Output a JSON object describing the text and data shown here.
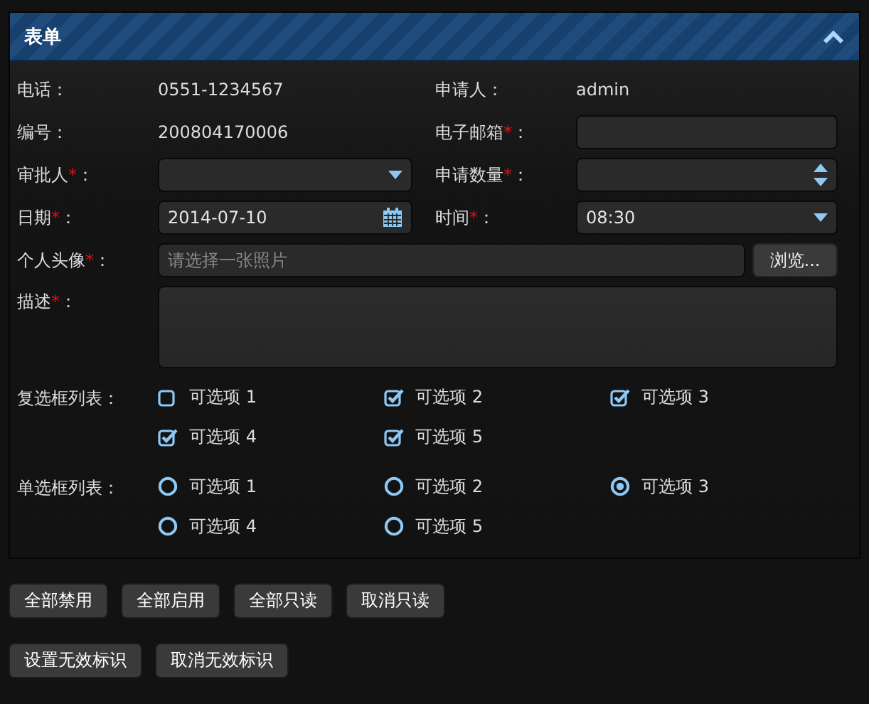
{
  "panel": {
    "title": "表单",
    "expanded": true
  },
  "fields": [
    {
      "kind": "text",
      "label": "电话：",
      "value": "0551-1234567"
    },
    {
      "kind": "text",
      "label": "申请人：",
      "value": "admin"
    },
    {
      "kind": "text",
      "label": "编号：",
      "value": "200804170006"
    },
    {
      "kind": "input",
      "label": "电子邮箱",
      "required_mark": "*",
      "colon": "："
    },
    {
      "kind": "select",
      "label": "审批人",
      "required_mark": "*",
      "colon": "："
    },
    {
      "kind": "spinner",
      "label": "申请数量",
      "required_mark": "*",
      "colon": "："
    },
    {
      "kind": "date",
      "label": "日期",
      "required_mark": "*",
      "colon": "：",
      "value": "2014-07-10"
    },
    {
      "kind": "select",
      "label": "时间",
      "required_mark": "*",
      "colon": "：",
      "value": "08:30"
    },
    {
      "kind": "file",
      "label": "个人头像",
      "required_mark": "*",
      "colon": "：",
      "placeholder": "请选择一张照片",
      "button": "浏览..."
    },
    {
      "kind": "textarea",
      "label": "描述",
      "required_mark": "*",
      "colon": "："
    }
  ],
  "checkbox_group": {
    "label": "复选框列表：",
    "options": [
      {
        "label": "可选项 1",
        "checked": false
      },
      {
        "label": "可选项 2",
        "checked": true
      },
      {
        "label": "可选项 3",
        "checked": true
      },
      {
        "label": "可选项 4",
        "checked": true
      },
      {
        "label": "可选项 5",
        "checked": true
      }
    ]
  },
  "radio_group": {
    "label": "单选框列表：",
    "options": [
      {
        "label": "可选项 1",
        "selected": false
      },
      {
        "label": "可选项 2",
        "selected": false
      },
      {
        "label": "可选项 3",
        "selected": true
      },
      {
        "label": "可选项 4",
        "selected": false
      },
      {
        "label": "可选项 5",
        "selected": false
      }
    ]
  },
  "button_rows": [
    [
      "全部禁用",
      "全部启用",
      "全部只读",
      "取消只读"
    ],
    [
      "设置无效标识",
      "取消无效标识"
    ]
  ]
}
